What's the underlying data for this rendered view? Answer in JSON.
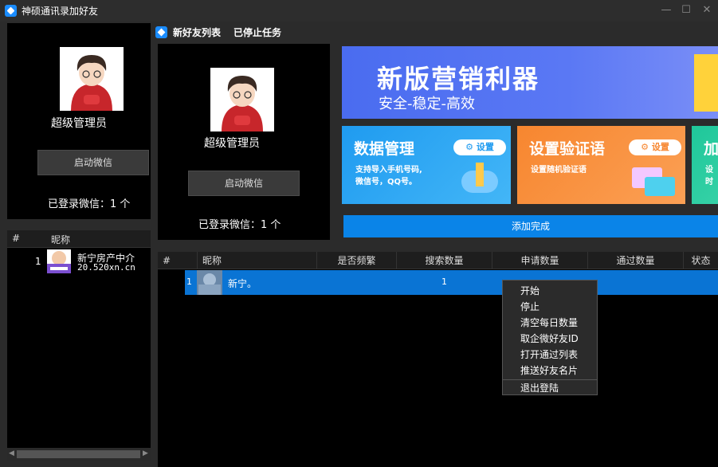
{
  "window": {
    "title": "神硕通讯录加好友",
    "minimize": "—",
    "maximize": "☐",
    "close": "✕"
  },
  "left_panel": {
    "admin_name": "超级管理员",
    "start_button": "启动微信",
    "logged_in": "已登录微信：1 个",
    "list": {
      "headers": {
        "num": "#",
        "nickname": "昵称"
      },
      "rows": [
        {
          "num": "1",
          "name": "新宁房产中介",
          "sub": "20.520xn.cn"
        }
      ],
      "scroll_left": "◀",
      "scroll_right": "▶"
    }
  },
  "nav": {
    "tabs": [
      {
        "label": "新好友列表"
      },
      {
        "label": "已停止任务"
      }
    ]
  },
  "account_panel": {
    "admin_name": "超级管理员",
    "start_button": "启动微信",
    "logged_in": "已登录微信：1 个"
  },
  "banner": {
    "title": "新版营销利器",
    "subtitle": "安全-稳定-高效"
  },
  "cards": [
    {
      "title": "数据管理",
      "pill": "设置",
      "desc_line1": "支持导入手机号码,",
      "desc_line2": "微信号，QQ号。",
      "color_from": "#1f9bf0",
      "color_to": "#43b6f7"
    },
    {
      "title": "设置验证语",
      "pill": "设置",
      "desc_line1": "设置随机验证语",
      "desc_line2": "",
      "color_from": "#f7862f",
      "color_to": "#fba055"
    },
    {
      "title": "加",
      "pill": "",
      "desc_line1": "设",
      "desc_line2": "时",
      "color_from": "#1fc79a",
      "color_to": "#35d1a6"
    }
  ],
  "add_done": "添加完成",
  "table": {
    "headers": [
      "#",
      "昵称",
      "是否频繁",
      "搜索数量",
      "申请数量",
      "通过数量",
      "状态"
    ],
    "rows": [
      {
        "num": "1",
        "nickname": "新宁。",
        "search_count": "1"
      }
    ]
  },
  "context_menu": {
    "items": [
      "开始",
      "停止",
      "清空每日数量",
      "取企微好友ID",
      "打开通过列表",
      "推送好友名片",
      "退出登陆"
    ]
  }
}
